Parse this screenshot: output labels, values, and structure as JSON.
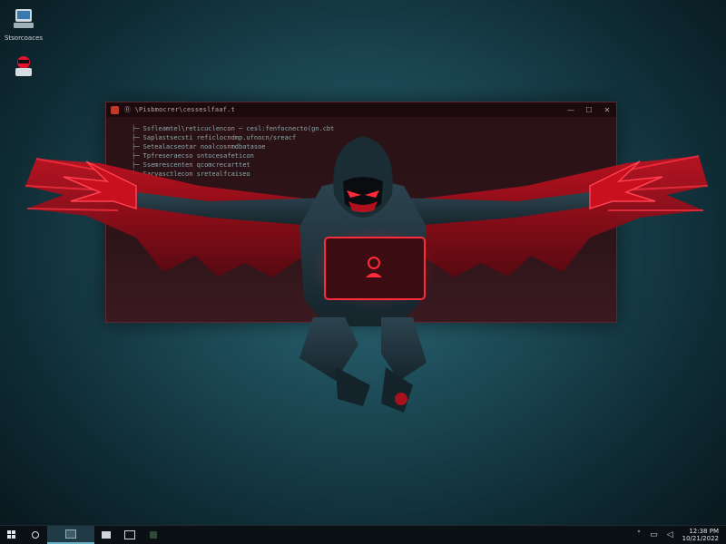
{
  "desktop": {
    "icons": [
      {
        "label": "Stsorcoaces",
        "icon": "drive-icon"
      },
      {
        "label": "",
        "icon": "app-shortcut-icon"
      }
    ]
  },
  "window": {
    "title": "Ⓡ \\Pisbmocrer\\cesseslfaaf.t",
    "controls": [
      "—",
      "☐",
      "✕"
    ],
    "lines": [
      "├─ Ssfleamtel\\reticuclencon ─ cesl:fenfocnecto(gn.cbt",
      "├─ Saplastsecsti  reficlocndmp.ufnocn/sreacf",
      "├─ Setealacseotar  noalcosnmdbatasoe",
      "├─ Tpfreseraecso  sntocesafeticon",
      "├─ Ssemrescenten  qcomcrecarttet",
      "└─ Sarvasctlecon  sretealfcaiseo"
    ]
  },
  "taskbar": {
    "start_icon": "windows-start-icon",
    "search_icon": "search-circle-icon",
    "apps": [
      "terminal-app-icon",
      "folder-app-icon",
      "browser-app-icon",
      "hacker-app-icon"
    ],
    "tray_icons": [
      "chevron-up-icon",
      "network-icon",
      "volume-icon"
    ],
    "clock_time": "12:38 PM",
    "clock_date": "10/21/2022"
  },
  "colors": {
    "accent_red": "#e0152d",
    "desktop_teal": "#2f6f7e",
    "taskbar": "#0a1014"
  }
}
